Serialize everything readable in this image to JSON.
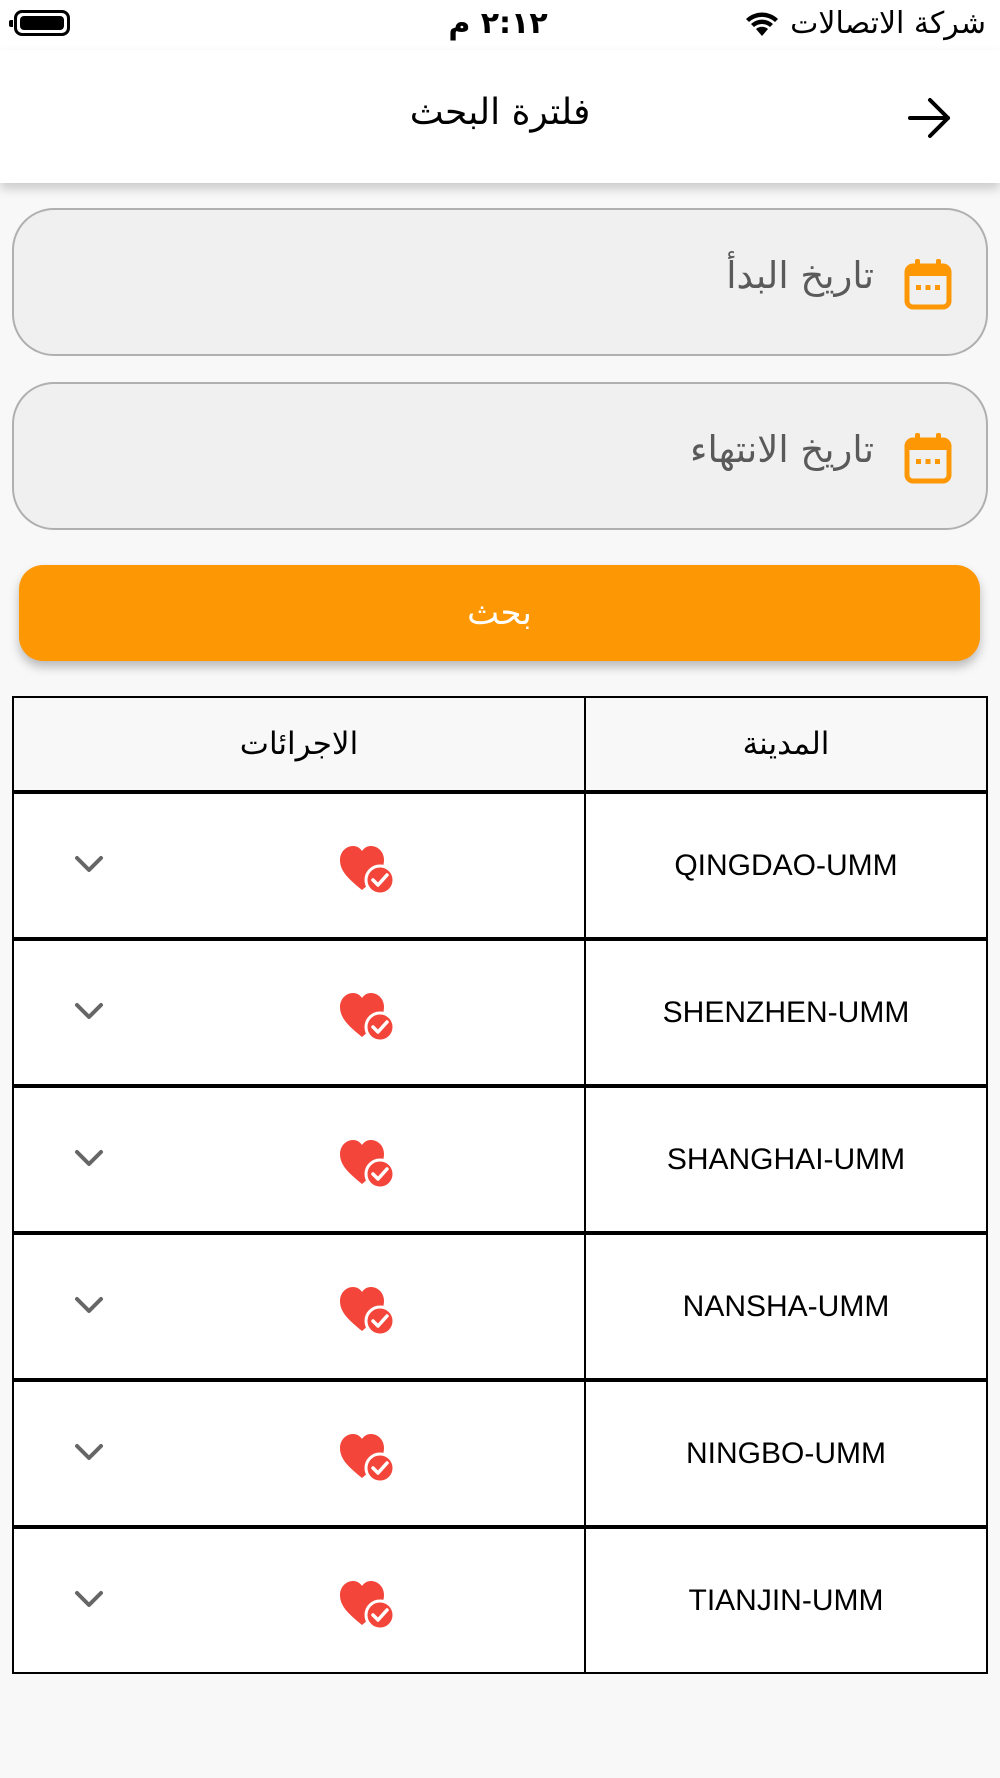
{
  "status_bar": {
    "time": "٢:١٢ م",
    "carrier": "شركة الاتصالات"
  },
  "header": {
    "title": "فلترة البحث",
    "back_icon": "arrow-right-icon"
  },
  "filters": {
    "start_date_placeholder": "تاريخ البدأ",
    "end_date_placeholder": "تاريخ الانتهاء",
    "calendar_icon": "calendar-icon",
    "accent_color": "#fd9704"
  },
  "search_button": {
    "label": "بحث",
    "color": "#fd9704"
  },
  "table": {
    "headers": {
      "city": "المدينة",
      "actions": "الاجرائات"
    },
    "rows": [
      {
        "city": "QINGDAO-UMM"
      },
      {
        "city": "SHENZHEN-UMM"
      },
      {
        "city": "SHANGHAI-UMM"
      },
      {
        "city": "NANSHA-UMM"
      },
      {
        "city": "NINGBO-UMM"
      },
      {
        "city": "TIANJIN-UMM"
      }
    ],
    "row_icons": [
      "heart-check-icon",
      "chevron-down-icon"
    ],
    "heart_color": "#f4453a"
  }
}
